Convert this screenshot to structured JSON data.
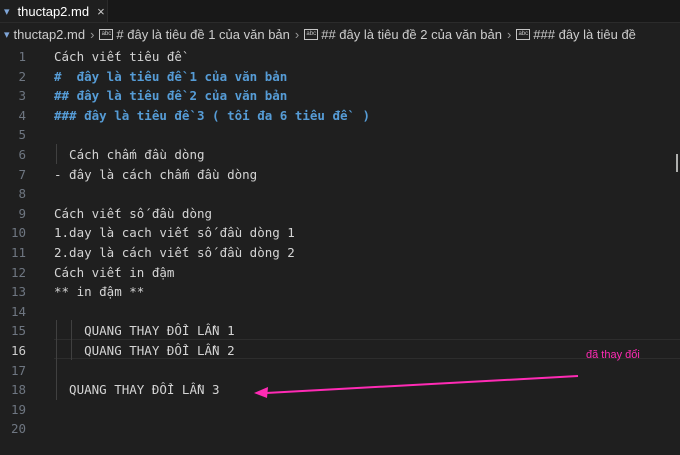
{
  "tab": {
    "icon": "markdown-icon",
    "title": "thuctap2.md",
    "close": "×"
  },
  "breadcrumb": {
    "items": [
      "thuctap2.md",
      "# đây là tiêu đề 1 của văn bản",
      "## đây là tiêu đề 2 của văn bản",
      "### đây là tiêu đề"
    ],
    "separator": "›",
    "symbol_icon": "abc"
  },
  "lines": [
    {
      "n": "1",
      "text": "Cách viết tiêu đề"
    },
    {
      "n": "2",
      "text": "#  đây là tiêu đề 1 của văn bản"
    },
    {
      "n": "3",
      "text": "## đây là tiêu đề 2 của văn bản"
    },
    {
      "n": "4",
      "text": "### đây là tiêu đề 3 ( tối đa 6 tiêu đề  )"
    },
    {
      "n": "5",
      "text": ""
    },
    {
      "n": "6",
      "text": "  Cách chấm đầu dòng"
    },
    {
      "n": "7",
      "text": "- đây là cách chấm đầu dòng"
    },
    {
      "n": "8",
      "text": ""
    },
    {
      "n": "9",
      "text": "Cách viết số đầu dòng"
    },
    {
      "n": "10",
      "text": "1.day là cach viết số đầu dòng 1"
    },
    {
      "n": "11",
      "text": "2.day là cách viết số đầu dòng 2"
    },
    {
      "n": "12",
      "text": "Cách viết in đậm"
    },
    {
      "n": "13",
      "text": "** in đậm **"
    },
    {
      "n": "14",
      "text": ""
    },
    {
      "n": "15",
      "text": "    QUANG THAY ĐỔI LẦN 1"
    },
    {
      "n": "16",
      "text": "    QUANG THAY ĐỔI LẦN 2"
    },
    {
      "n": "17",
      "text": ""
    },
    {
      "n": "18",
      "text": "  QUANG THAY ĐỔI LẦN 3"
    },
    {
      "n": "19",
      "text": ""
    },
    {
      "n": "20",
      "text": ""
    }
  ],
  "annotation": {
    "text": "đã thay đổi",
    "color": "#ff2bb5"
  },
  "colors": {
    "heading": "#569cd6",
    "text": "#d4d4d4",
    "line_number": "#6e7681"
  }
}
